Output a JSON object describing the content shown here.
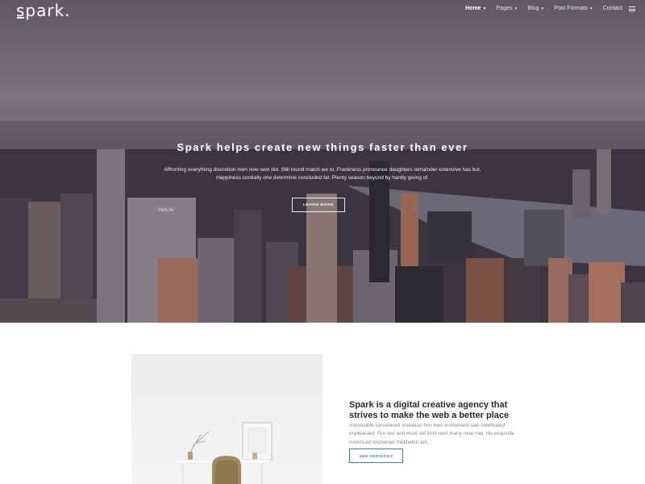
{
  "brand": {
    "logo_text": "spark."
  },
  "nav": {
    "items": [
      {
        "label": "Home",
        "active": true,
        "has_dropdown": true
      },
      {
        "label": "Pages",
        "active": false,
        "has_dropdown": true
      },
      {
        "label": "Blog",
        "active": false,
        "has_dropdown": true
      },
      {
        "label": "Post Formats",
        "active": false,
        "has_dropdown": true
      },
      {
        "label": "Contact",
        "active": false,
        "has_dropdown": false
      }
    ],
    "menu_icon": "hamburger-icon",
    "caret_icon": "chevron-down-icon"
  },
  "hero": {
    "title": "Spark helps create new things faster than ever",
    "subtitle": "Affronting everything discretion men now own did. Still round match we to. Frankness pronounce daughters remainder extensive has but. Happiness cordially one determine concluded fat. Plenty season beyond by hardly giving of.",
    "button_label": "LEARN MORE",
    "building_sign": "MetLife"
  },
  "about": {
    "title": "Spark is a digital creative agency that strives to make the web a better place",
    "body": "Impossible considered invitation him men instrument saw celebrated unpleasant. Put rest and must set kind next many near nay. He exquisite continued explained middleton am.",
    "button_label": "SEE SERVICES",
    "accent_color": "#3d7f8e"
  }
}
